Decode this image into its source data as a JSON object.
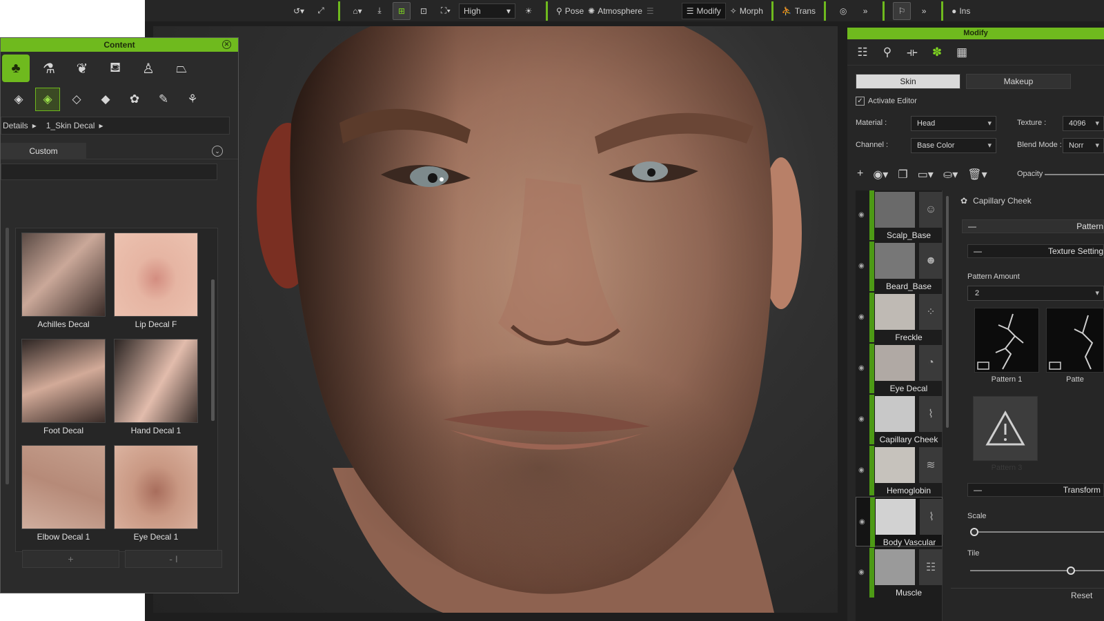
{
  "toolbar": {
    "quality_value": "High",
    "pose_label": "Pose",
    "atmosphere_label": "Atmosphere",
    "dim_label": "",
    "modify_label": "Modify",
    "morph_label": "Morph",
    "trans_label": "Trans",
    "ins_label": "Ins",
    "more1": "»",
    "more2": "»"
  },
  "content_panel": {
    "title": "Content",
    "breadcrumb": [
      "Details",
      "1_Skin Decal"
    ],
    "tab_label": "Custom",
    "items": [
      {
        "label": "Achilles Decal"
      },
      {
        "label": "Lip Decal F"
      },
      {
        "label": "Foot Decal"
      },
      {
        "label": "Hand Decal 1"
      },
      {
        "label": "Elbow Decal 1"
      },
      {
        "label": "Eye Decal 1"
      }
    ],
    "add_symbol": "+",
    "remove_symbol": "- I"
  },
  "modify_panel": {
    "title": "Modify",
    "tabs": [
      "Skin",
      "Makeup"
    ],
    "activate_editor": "Activate Editor",
    "material_label": "Material :",
    "material_value": "Head",
    "texture_label": "Texture :",
    "texture_value": "4096",
    "channel_label": "Channel :",
    "channel_value": "Base Color",
    "blend_label": "Blend Mode :",
    "blend_value": "Norr",
    "opacity_label": "Opacity",
    "layers": [
      {
        "name": "Scalp_Base"
      },
      {
        "name": "Beard_Base"
      },
      {
        "name": "Freckle"
      },
      {
        "name": "Eye Decal"
      },
      {
        "name": "Capillary Cheek"
      },
      {
        "name": "Hemoglobin"
      },
      {
        "name": "Body Vascular"
      },
      {
        "name": "Muscle"
      }
    ],
    "selected_layer_title": "Capillary Cheek",
    "pattern_section": "Pattern",
    "texture_settings": "Texture Setting",
    "pattern_amount_label": "Pattern Amount",
    "pattern_amount_value": "2",
    "pattern_items": [
      "Pattern 1",
      "Patte"
    ],
    "pattern_missing_label": "Pattern 3",
    "transform_section": "Transform",
    "scale_label": "Scale",
    "scale_value": 0.03,
    "tile_label": "Tile",
    "tile_value": 0.75,
    "reset_label": "Reset"
  }
}
